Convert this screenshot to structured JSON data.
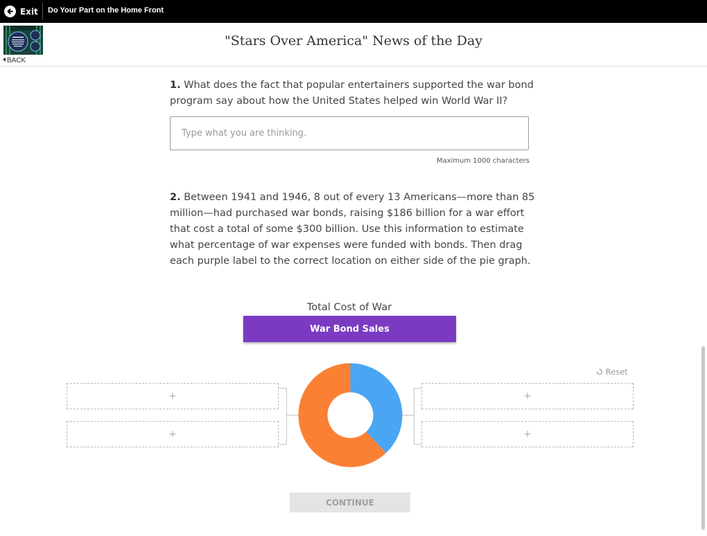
{
  "topbar": {
    "exit_label": "Exit",
    "title": "Do Your Part on the Home Front"
  },
  "header": {
    "back_label": "BACK",
    "page_title": "\"Stars Over America\" News of the Day"
  },
  "question1": {
    "number": "1.",
    "text": "What does the fact that popular entertainers supported the war bond program say about how the United States helped win World War II?",
    "placeholder": "Type what you are thinking.",
    "max_chars": "Maximum 1000 characters"
  },
  "question2": {
    "number": "2.",
    "text": "Between 1941 and 1946, 8 out of every 13 Americans—more than 85 million—had purchased war bonds, raising $186 billion for a war effort that cost a total of some $300 billion. Use this information to estimate what percentage of war expenses were funded with bonds. Then drag each purple label to the correct location on either side of the pie graph."
  },
  "activity": {
    "chart_title": "Total Cost of War",
    "draggable_label": "War Bond Sales",
    "reset_label": "Reset",
    "drop_placeholder": "+",
    "continue_label": "CONTINUE"
  },
  "chart_data": {
    "type": "pie",
    "style": "donut",
    "segments": [
      {
        "value": 38,
        "color": "#4aa6f2"
      },
      {
        "value": 62,
        "color": "#fa8033"
      }
    ]
  },
  "colors": {
    "purple_label": "#7a3bc2",
    "blue_segment": "#4aa6f2",
    "orange_segment": "#fa8033"
  },
  "icons": {
    "exit": "arrow-left-circle-icon",
    "back": "caret-left-icon",
    "reset": "refresh-icon"
  }
}
